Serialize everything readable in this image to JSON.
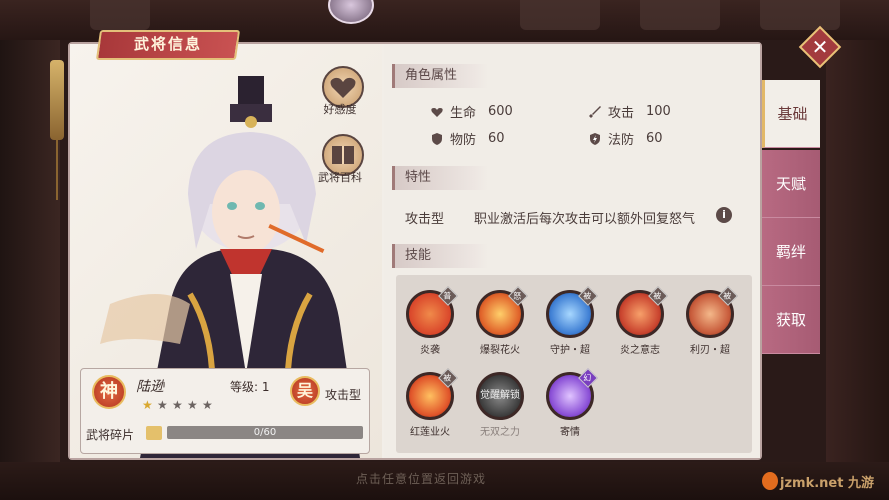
{
  "window": {
    "title": "武将信息",
    "close_icon": "close-icon"
  },
  "character": {
    "name": "陆逊",
    "level_label": "等级: 1",
    "rank_seal": "神",
    "faction_seal": "吴",
    "type": "攻击型",
    "stars_filled": 1,
    "stars_total": 5,
    "fragments_label": "武将碎片",
    "fragments_progress": "0/60",
    "fragments_fraction": 0
  },
  "portrait_buttons": [
    {
      "label": "好感度",
      "icon": "heart-icon"
    },
    {
      "label": "武将百科",
      "icon": "book-icon"
    }
  ],
  "attributes": {
    "heading": "角色属性",
    "items": [
      {
        "label": "生命",
        "value": "600",
        "icon": "heart-icon"
      },
      {
        "label": "攻击",
        "value": "100",
        "icon": "sword-icon"
      },
      {
        "label": "物防",
        "value": "60",
        "icon": "shield-icon"
      },
      {
        "label": "法防",
        "value": "60",
        "icon": "lightning-shield-icon"
      }
    ]
  },
  "trait": {
    "heading": "特性",
    "label": "攻击型",
    "description": "职业激活后每次攻击可以额外回复怒气"
  },
  "skills": {
    "heading": "技能",
    "items": [
      {
        "label": "炎袭",
        "badge": "普",
        "color": "#d9452a",
        "locked": false
      },
      {
        "label": "爆裂花火",
        "badge": "怒",
        "color": "#e0622a",
        "locked": false
      },
      {
        "label": "守护・超",
        "badge": "被",
        "color": "#3f7fd4",
        "locked": false
      },
      {
        "label": "炎之意志",
        "badge": "被",
        "color": "#c9432e",
        "locked": false
      },
      {
        "label": "利刃・超",
        "badge": "被",
        "color": "#c75a3a",
        "locked": false
      },
      {
        "label": "红莲业火",
        "badge": "被",
        "color": "#e0542a",
        "locked": false
      },
      {
        "label": "无双之力",
        "badge": "",
        "color": "#555",
        "locked": true,
        "overlay": "觉醒解锁"
      },
      {
        "label": "寄情",
        "badge": "幻",
        "color": "#8a4fd6",
        "locked": false
      }
    ]
  },
  "tabs": [
    {
      "label": "基础",
      "active": true
    },
    {
      "label": "天赋",
      "active": false
    },
    {
      "label": "羁绊",
      "active": false
    },
    {
      "label": "获取",
      "active": false
    }
  ],
  "hint": "点击任意位置返回游戏",
  "watermark": "jzmk.net 九游"
}
